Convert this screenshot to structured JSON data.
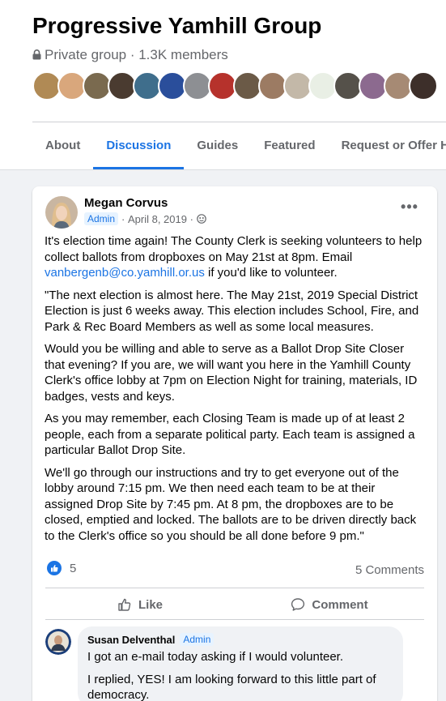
{
  "group": {
    "title": "Progressive Yamhill Group",
    "meta": "Private group · 1.3K members"
  },
  "tabs": [
    "About",
    "Discussion",
    "Guides",
    "Featured",
    "Request or Offer Help"
  ],
  "active_tab": "Discussion",
  "post": {
    "author": "Megan Corvus",
    "badge": "Admin",
    "date": "April 8, 2019",
    "para1_a": "It's election time again! The County Clerk is seeking volunteers to help collect ballots from dropboxes on May 21st at 8pm. Email ",
    "para1_email": "vanbergenb@co.yamhill.or.us",
    "para1_b": " if you'd like to volunteer.",
    "para2": "\"The next election is almost here. The May 21st, 2019 Special District Election is just 6 weeks away. This election includes School, Fire, and Park & Rec Board Members as well as some local measures.",
    "para3": "Would you be willing and able to serve as a Ballot Drop Site Closer that evening? If you are, we will want you here in the Yamhill County Clerk's office lobby at 7pm on Election Night for training, materials, ID badges, vests and keys.",
    "para4": "As you may remember, each Closing Team is made up of at least 2 people, each from a separate political party. Each team is assigned a particular Ballot Drop Site.",
    "para5": "We'll go through our instructions and try to get everyone out of the lobby around 7:15 pm. We then need each team to be at their assigned Drop Site by 7:45 pm. At 8 pm, the dropboxes are to be closed, emptied and locked. The ballots are to be driven directly back to the Clerk's office so you should be all done before 9 pm.\"",
    "reaction_count": "5",
    "comment_count": "5 Comments",
    "like_label": "Like",
    "comment_label": "Comment"
  },
  "comment": {
    "author": "Susan Delventhal",
    "badge": "Admin",
    "line1": "I got an e-mail today asking if I would volunteer.",
    "line2": "I replied, YES! I am looking forward to this little part of democracy."
  },
  "colors": {
    "accent": "#1b74e4",
    "secondary_text": "#65676b",
    "page_bg": "#f0f2f5"
  }
}
